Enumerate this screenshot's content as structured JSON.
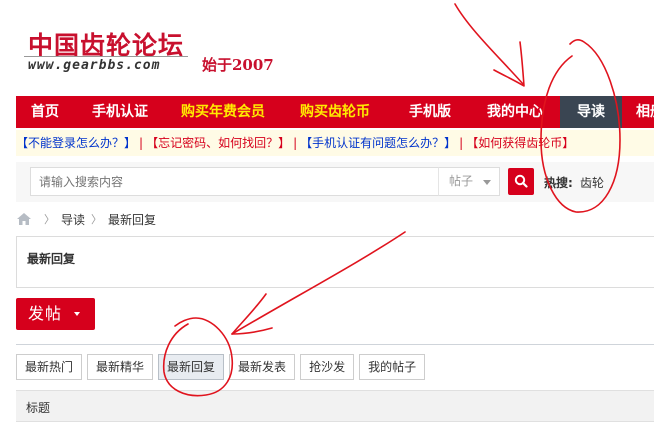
{
  "logo": {
    "title": "中国齿轮论坛",
    "url": "www.gearbbs.com",
    "since": "始于2007"
  },
  "nav": {
    "items": [
      "首页",
      "手机认证",
      "购买年费会员",
      "购买齿轮币",
      "手机版",
      "我的中心",
      "导读",
      "相册"
    ]
  },
  "notice": {
    "items": [
      "【不能登录怎么办？】",
      "【忘记密码、如何找回？】",
      "【手机认证有问题怎么办？】",
      "【如何获得齿轮币】"
    ],
    "separator": "|"
  },
  "search": {
    "placeholder": "请输入搜索内容",
    "type": "帖子",
    "hot_label": "热搜:",
    "hot_keyword": "齿轮"
  },
  "breadcrumb": {
    "items": [
      "导读",
      "最新回复"
    ],
    "separator": "〉"
  },
  "section": {
    "title": "最新回复"
  },
  "post_button": {
    "label": "发帖"
  },
  "tabs": {
    "items": [
      "最新热门",
      "最新精华",
      "最新回复",
      "最新发表",
      "抢沙发",
      "我的帖子"
    ],
    "active_index": 2
  },
  "table": {
    "header_title": "标题"
  },
  "colors": {
    "brand_red": "#d6001c",
    "nav_gold": "#ffea00",
    "nav_active": "#3a4552",
    "notice_blue": "#0033cc",
    "annotation_red": "#e0141e"
  }
}
